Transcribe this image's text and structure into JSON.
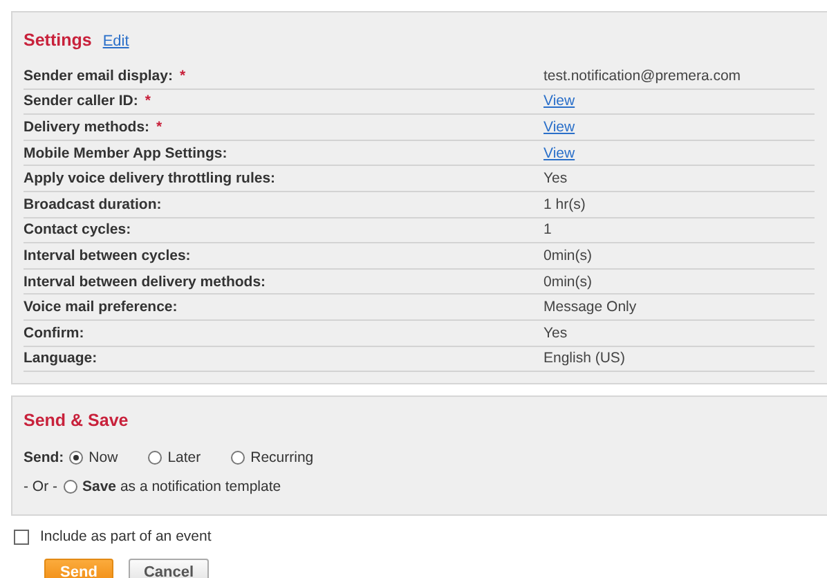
{
  "settings": {
    "title": "Settings",
    "edit_link": "Edit",
    "rows": [
      {
        "label": "Sender email display:",
        "required": true,
        "value": "test.notification@premera.com",
        "kind": "text"
      },
      {
        "label": "Sender caller ID:",
        "required": true,
        "value": "View",
        "kind": "link"
      },
      {
        "label": "Delivery methods:",
        "required": true,
        "value": "View",
        "kind": "link"
      },
      {
        "label": "Mobile Member App Settings:",
        "required": false,
        "value": "View",
        "kind": "link"
      },
      {
        "label": "Apply voice delivery throttling rules:",
        "required": false,
        "value": "Yes",
        "kind": "text"
      },
      {
        "label": "Broadcast duration:",
        "required": false,
        "value": "1 hr(s)",
        "kind": "text"
      },
      {
        "label": "Contact cycles:",
        "required": false,
        "value": "1",
        "kind": "text"
      },
      {
        "label": "Interval between cycles:",
        "required": false,
        "value": "0min(s)",
        "kind": "text"
      },
      {
        "label": "Interval between delivery methods:",
        "required": false,
        "value": "0min(s)",
        "kind": "text"
      },
      {
        "label": "Voice mail preference:",
        "required": false,
        "value": "Message Only",
        "kind": "text"
      },
      {
        "label": "Confirm:",
        "required": false,
        "value": "Yes",
        "kind": "text"
      },
      {
        "label": "Language:",
        "required": false,
        "value": "English (US)",
        "kind": "text"
      }
    ],
    "required_mark": "*"
  },
  "send_save": {
    "title": "Send & Save",
    "send_label": "Send:",
    "send_options": [
      {
        "label": "Now",
        "selected": true
      },
      {
        "label": "Later",
        "selected": false
      },
      {
        "label": "Recurring",
        "selected": false
      }
    ],
    "or_label": "- Or -",
    "save_option": {
      "label": "**Save** as a notification template",
      "selected": false
    }
  },
  "include_event": {
    "label": "Include as part of an event",
    "checked": false
  },
  "buttons": [
    {
      "label": "Send",
      "kind": "primary"
    },
    {
      "label": "Cancel",
      "kind": "secondary"
    }
  ]
}
